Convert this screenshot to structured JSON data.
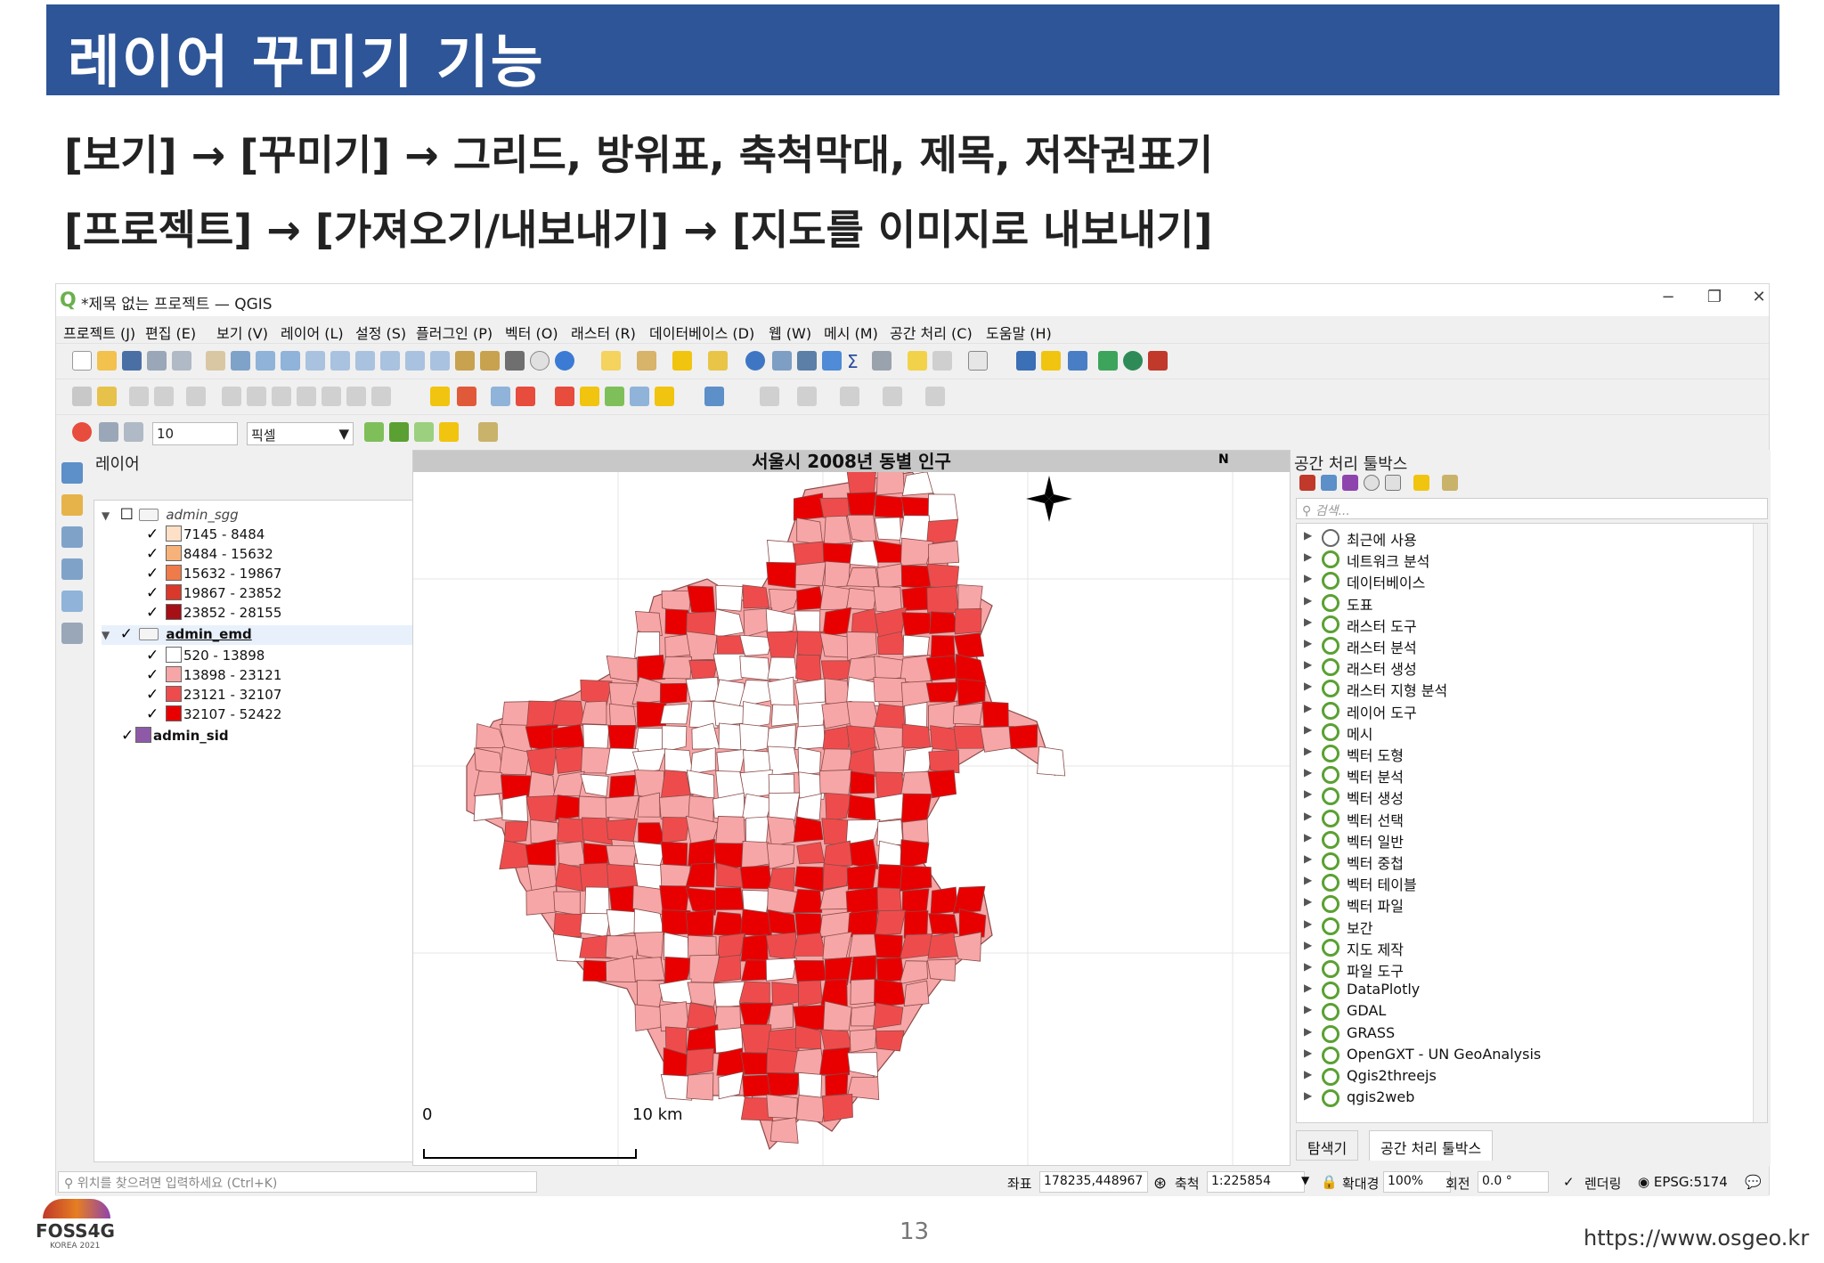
{
  "slide": {
    "title": "레이어 꾸미기 기능",
    "bullet1": "[보기] → [꾸미기] → 그리드, 방위표, 축척막대, 제목, 저작권표기",
    "bullet2": "[프로젝트] → [가져오기/내보내기] → [지도를 이미지로 내보내기]",
    "page_number": "13",
    "footer_url": "https://www.osgeo.kr",
    "logo_text": "FOSS4G",
    "logo_sub": "KOREA 2021"
  },
  "window": {
    "title": "*제목 없는 프로젝트 — QGIS",
    "controls": [
      "−",
      "❐",
      "✕"
    ]
  },
  "menu": [
    "프로젝트 (J)",
    "편집 (E)",
    "보기 (V)",
    "레이어 (L)",
    "설정 (S)",
    "플러그인 (P)",
    "벡터 (O)",
    "래스터 (R)",
    "데이터베이스 (D)",
    "웹 (W)",
    "메시 (M)",
    "공간 처리 (C)",
    "도움말 (H)"
  ],
  "snapping": {
    "tolerance": "10",
    "unit": "픽셀"
  },
  "layers_panel": {
    "title": "레이어",
    "groups": [
      {
        "name": "admin_sgg",
        "classes": [
          {
            "label": "7145 - 8484",
            "color": "#fde0c5"
          },
          {
            "label": "8484 - 15632",
            "color": "#f7b27a"
          },
          {
            "label": "15632 - 19867",
            "color": "#ef7b4a"
          },
          {
            "label": "19867 - 23852",
            "color": "#d9392b"
          },
          {
            "label": "23852 - 28155",
            "color": "#a50f15"
          }
        ]
      },
      {
        "name": "admin_emd",
        "classes": [
          {
            "label": "520 - 13898",
            "color": "#ffffff"
          },
          {
            "label": "13898 - 23121",
            "color": "#f6a6a6"
          },
          {
            "label": "23121 - 32107",
            "color": "#ee4c4c"
          },
          {
            "label": "32107 - 52422",
            "color": "#e80000"
          }
        ]
      }
    ],
    "single_layer": {
      "name": "admin_sid",
      "color": "#8e5aa8"
    }
  },
  "map": {
    "title": "서울시 2008년 동별 인구",
    "north": "N",
    "scale_start": "0",
    "scale_end": "10 km"
  },
  "toolbox": {
    "title": "공간 처리 툴박스",
    "search_placeholder": "검색...",
    "items": [
      "최근에 사용",
      "네트워크 분석",
      "데이터베이스",
      "도표",
      "래스터 도구",
      "래스터 분석",
      "래스터 생성",
      "래스터 지형 분석",
      "레이어 도구",
      "메시",
      "벡터 도형",
      "벡터 분석",
      "벡터 생성",
      "벡터 선택",
      "벡터 일반",
      "벡터 중첩",
      "벡터 테이블",
      "벡터 파일",
      "보간",
      "지도 제작",
      "파일 도구",
      "DataPlotly",
      "GDAL",
      "GRASS",
      "OpenGXT - UN GeoAnalysis",
      "Qgis2threejs",
      "qgis2web"
    ],
    "tabs": [
      "탐색기",
      "공간 처리 툴박스"
    ]
  },
  "statusbar": {
    "locator_placeholder": "위치를 찾으려면 입력하세요 (Ctrl+K)",
    "coord_label": "좌표",
    "coord_value": "178235,448967",
    "scale_label": "축척",
    "scale_value": "1:225854",
    "magnifier_label": "확대경",
    "magnifier_value": "100%",
    "rotation_label": "회전",
    "rotation_value": "0.0 °",
    "render_label": "렌더링",
    "crs": "EPSG:5174"
  },
  "colors": {
    "header_blue": "#2e5597",
    "choropleth": [
      "#ffffff",
      "#f6a6a6",
      "#ee4c4c",
      "#e80000"
    ]
  }
}
